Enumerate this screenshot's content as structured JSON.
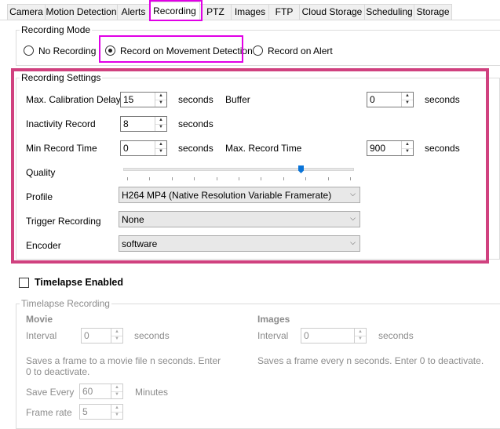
{
  "tabs": [
    {
      "label": "Camera"
    },
    {
      "label": "Motion Detection"
    },
    {
      "label": "Alerts"
    },
    {
      "label": "Recording"
    },
    {
      "label": "PTZ"
    },
    {
      "label": "Images"
    },
    {
      "label": "FTP"
    },
    {
      "label": "Cloud Storage"
    },
    {
      "label": "Scheduling"
    },
    {
      "label": "Storage"
    }
  ],
  "active_tab": "Recording",
  "recording_mode": {
    "title": "Recording Mode",
    "options": [
      {
        "label": "No Recording",
        "checked": false
      },
      {
        "label": "Record on Movement Detection",
        "checked": true
      },
      {
        "label": "Record on Alert",
        "checked": false
      }
    ]
  },
  "recording_settings": {
    "title": "Recording Settings",
    "max_calibration_delay": {
      "label": "Max. Calibration Delay",
      "value": "15",
      "unit": "seconds"
    },
    "buffer": {
      "label": "Buffer",
      "value": "0",
      "unit": "seconds"
    },
    "inactivity_record": {
      "label": "Inactivity Record",
      "value": "8",
      "unit": "seconds"
    },
    "min_record_time": {
      "label": "Min Record Time",
      "value": "0",
      "unit": "seconds"
    },
    "max_record_time": {
      "label": "Max. Record Time",
      "value": "900",
      "unit": "seconds"
    },
    "quality": {
      "label": "Quality",
      "level_fraction": 0.77
    },
    "profile": {
      "label": "Profile",
      "value": "H264 MP4 (Native Resolution Variable Framerate)"
    },
    "trigger_recording": {
      "label": "Trigger Recording",
      "value": "None"
    },
    "encoder": {
      "label": "Encoder",
      "value": "software"
    }
  },
  "timelapse": {
    "enabled_label": "Timelapse Enabled",
    "enabled": false,
    "group_title": "Timelapse Recording",
    "movie": {
      "title": "Movie",
      "interval_label": "Interval",
      "interval_value": "0",
      "interval_unit": "seconds",
      "description": "Saves a frame to a movie file n seconds. Enter 0 to deactivate.",
      "save_every_label": "Save Every",
      "save_every_value": "60",
      "save_every_unit": "Minutes",
      "frame_rate_label": "Frame rate",
      "frame_rate_value": "5"
    },
    "images": {
      "title": "Images",
      "interval_label": "Interval",
      "interval_value": "0",
      "interval_unit": "seconds",
      "description": "Saves a frame every n seconds. Enter 0 to deactivate."
    }
  },
  "colors": {
    "tab_highlight": "#e100e6",
    "settings_highlight": "#d0417f",
    "slider_thumb": "#0a74d8"
  }
}
